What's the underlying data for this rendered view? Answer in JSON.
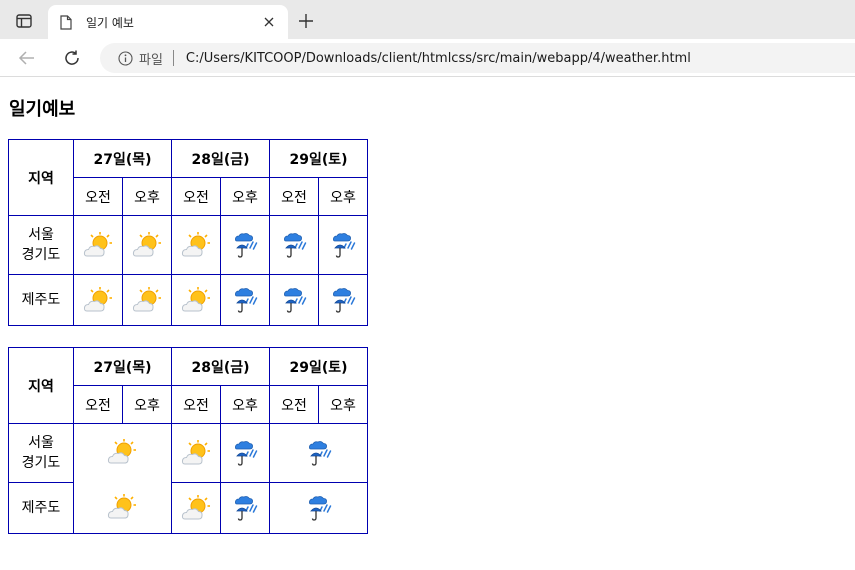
{
  "browser": {
    "tab_title": "일기 예보",
    "address_scheme": "파일",
    "address_url": "C:/Users/KITCOOP/Downloads/client/htmlcss/src/main/webapp/4/weather.html"
  },
  "page": {
    "title": "일기예보",
    "region_header": "지역",
    "days": [
      "27일(목)",
      "28일(금)",
      "29일(토)"
    ],
    "ampm": [
      "오전",
      "오후"
    ],
    "regions": [
      {
        "line1": "서울",
        "line2": "경기도"
      },
      {
        "line1": "제주도",
        "line2": ""
      }
    ]
  },
  "icons": {
    "sunny": "sun-cloud-icon",
    "rain": "rain-umbrella-icon"
  },
  "colors": {
    "table_border": "#0000b0"
  }
}
